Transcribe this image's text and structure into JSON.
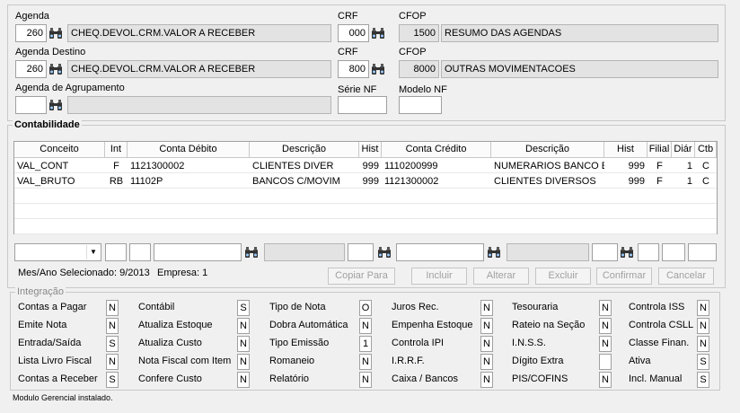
{
  "agenda": {
    "label": "Agenda",
    "code": "260",
    "desc": "CHEQ.DEVOL.CRM.VALOR A RECEBER"
  },
  "crf1": {
    "label": "CRF",
    "value": "000"
  },
  "cfop1": {
    "label": "CFOP",
    "code": "1500",
    "desc": "RESUMO DAS AGENDAS"
  },
  "agenda_destino": {
    "label": "Agenda Destino",
    "code": "260",
    "desc": "CHEQ.DEVOL.CRM.VALOR A RECEBER"
  },
  "crf2": {
    "label": "CRF",
    "value": "800"
  },
  "cfop2": {
    "label": "CFOP",
    "code": "8000",
    "desc": "OUTRAS MOVIMENTACOES"
  },
  "agrupamento": {
    "label": "Agenda de Agrupamento",
    "code": "",
    "desc": ""
  },
  "serie_nf": {
    "label": "Série NF",
    "value": ""
  },
  "modelo_nf": {
    "label": "Modelo NF",
    "value": ""
  },
  "contabilidade": {
    "title": "Contabilidade",
    "columns": [
      "Conceito",
      "Int",
      "Conta Débito",
      "Descrição",
      "Hist",
      "Conta Crédito",
      "Descrição",
      "Hist",
      "Filial",
      "Diár",
      "Ctb"
    ],
    "rows": [
      [
        "VAL_CONT",
        "F",
        "1121300002",
        "CLIENTES DIVER",
        "999",
        "1110200999",
        "NUMERARIOS BANCO EM",
        "999",
        "F",
        "1",
        "C"
      ],
      [
        "VAL_BRUTO",
        "RB",
        "11102P",
        "BANCOS C/MOVIM",
        "999",
        "1121300002",
        "CLIENTES DIVERSOS",
        "999",
        "F",
        "1",
        "C"
      ]
    ],
    "status": "Mes/Ano Selecionado: 9/2013",
    "empresa": "Empresa: 1",
    "buttons": [
      "Copiar Para",
      "Incluir",
      "Alterar",
      "Excluir",
      "Confirmar",
      "Cancelar"
    ]
  },
  "integracao": {
    "title": "Integração",
    "col1": [
      {
        "label": "Contas a Pagar",
        "v": "N"
      },
      {
        "label": "Emite Nota",
        "v": "N"
      },
      {
        "label": "Entrada/Saída",
        "v": "S"
      },
      {
        "label": "Lista Livro Fiscal",
        "v": "N"
      },
      {
        "label": "Contas a Receber",
        "v": "S"
      }
    ],
    "col2": [
      {
        "label": "Contábil",
        "v": "S"
      },
      {
        "label": "Atualiza Estoque",
        "v": "N"
      },
      {
        "label": "Atualiza Custo",
        "v": "N"
      },
      {
        "label": "Nota Fiscal com Item",
        "v": "N"
      },
      {
        "label": "Confere Custo",
        "v": "N"
      }
    ],
    "col3": [
      {
        "label": "Tipo de Nota",
        "v": "O"
      },
      {
        "label": "Dobra Automática",
        "v": "N"
      },
      {
        "label": "Tipo Emissão",
        "v": "1"
      },
      {
        "label": "Romaneio",
        "v": "N"
      },
      {
        "label": "Relatório",
        "v": "N"
      }
    ],
    "col4": [
      {
        "label": "Juros Rec.",
        "v": "N"
      },
      {
        "label": "Empenha Estoque",
        "v": "N"
      },
      {
        "label": "Controla IPI",
        "v": "N"
      },
      {
        "label": "I.R.R.F.",
        "v": "N"
      },
      {
        "label": "Caixa / Bancos",
        "v": "N"
      }
    ],
    "col5": [
      {
        "label": "Tesouraria",
        "v": "N"
      },
      {
        "label": "Rateio na Seção",
        "v": "N"
      },
      {
        "label": "I.N.S.S.",
        "v": "N"
      },
      {
        "label": "Dígito Extra",
        "v": ""
      },
      {
        "label": "PIS/COFINS",
        "v": "N"
      }
    ],
    "col6": [
      {
        "label": "Controla ISS",
        "v": "N"
      },
      {
        "label": "Controla CSLL",
        "v": "N"
      },
      {
        "label": "Classe Finan.",
        "v": "N"
      },
      {
        "label": "Ativa",
        "v": "S"
      },
      {
        "label": "Incl. Manual",
        "v": "S"
      }
    ]
  },
  "footer": "Modulo Gerencial instalado."
}
